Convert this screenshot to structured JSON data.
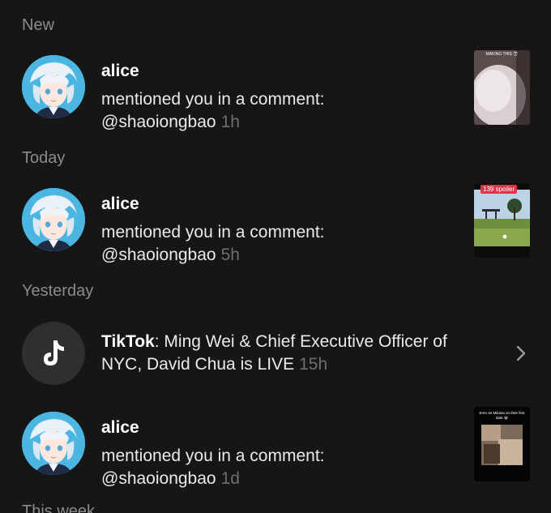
{
  "sections": {
    "new": "New",
    "today": "Today",
    "yesterday": "Yesterday",
    "this_week": "This week"
  },
  "notifications": [
    {
      "username": "alice",
      "message": "mentioned you in a comment:",
      "handle": "@shaoiongbao",
      "time": "1h",
      "thumb_caption": "MAKING THIS 👽"
    },
    {
      "username": "alice",
      "message": "mentioned you in a comment:",
      "handle": "@shaoiongbao",
      "time": "5h",
      "thumb_badge": "139 spoiler"
    },
    {
      "app": "TikTok",
      "message": ": Ming Wei & Chief Executive Officer of NYC, David Chua is LIVE",
      "time": "15h"
    },
    {
      "username": "alice",
      "message": "mentioned you in a comment:",
      "handle": "@shaoiongbao",
      "time": "1d",
      "thumb_caption": "Eren an Mikasa on their first date 😭"
    }
  ],
  "colors": {
    "background": "#161616",
    "muted": "#8b8b8b",
    "time": "#6f6f6f",
    "badge": "#e0334a"
  },
  "icons": {
    "tiktok": "tiktok-logo-icon",
    "chevron": "chevron-right-icon"
  }
}
